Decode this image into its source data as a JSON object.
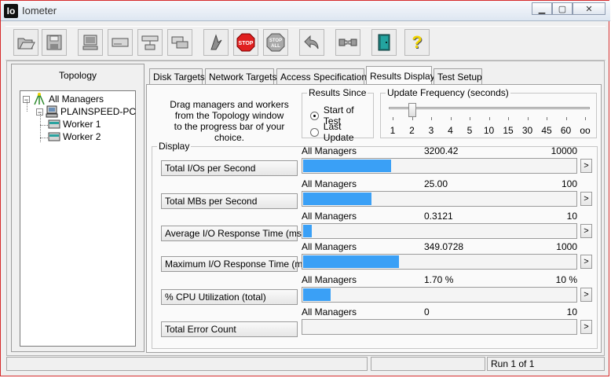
{
  "window": {
    "title": "Iometer",
    "icon_text": "Io"
  },
  "toolbar_icons": [
    "open-icon",
    "save-icon",
    "new-manager-icon",
    "new-disk-worker-icon",
    "new-network-worker-icon",
    "duplicate-worker-icon",
    "start-tests-icon",
    "stop-icon",
    "stop-all-icon",
    "reset-workers-icon",
    "disconnect-icon",
    "exit-icon",
    "about-icon"
  ],
  "toolbar_labels": {
    "stop": "STOP",
    "stop_all_top": "STOP",
    "stop_all_bottom": "ALL",
    "about": "?"
  },
  "topology": {
    "title": "Topology",
    "all_managers": "All Managers",
    "manager": "PLAINSPEED-PC",
    "workers": [
      "Worker 1",
      "Worker 2"
    ]
  },
  "tabs": [
    "Disk Targets",
    "Network Targets",
    "Access Specifications",
    "Results Display",
    "Test Setup"
  ],
  "active_tab": "Results Display",
  "instructions": [
    "Drag managers and workers",
    "from the Topology window",
    "to the progress bar of your choice."
  ],
  "results_since": {
    "label": "Results Since",
    "options": [
      "Start of Test",
      "Last Update"
    ],
    "selected": "Start of Test"
  },
  "update_frequency": {
    "label": "Update Frequency (seconds)",
    "ticks": [
      "1",
      "2",
      "3",
      "4",
      "5",
      "10",
      "15",
      "30",
      "45",
      "60",
      "oo"
    ],
    "selected": "2"
  },
  "display": {
    "label": "Display",
    "metrics": [
      {
        "button": "Total I/Os per Second",
        "scope": "All Managers",
        "value": "3200.42",
        "max": "10000",
        "fraction": 0.32
      },
      {
        "button": "Total MBs per Second",
        "scope": "All Managers",
        "value": "25.00",
        "max": "100",
        "fraction": 0.25
      },
      {
        "button": "Average I/O Response Time (ms)",
        "scope": "All Managers",
        "value": "0.3121",
        "max": "10",
        "fraction": 0.0312
      },
      {
        "button": "Maximum I/O Response Time (ms)",
        "scope": "All Managers",
        "value": "349.0728",
        "max": "1000",
        "fraction": 0.349
      },
      {
        "button": "% CPU Utilization (total)",
        "scope": "All Managers",
        "value": "1.70 %",
        "max": "10 %",
        "fraction": 0.1
      },
      {
        "button": "Total Error Count",
        "scope": "All Managers",
        "value": "0",
        "max": "10",
        "fraction": 0
      }
    ],
    "arrow_glyph": ">"
  },
  "status": {
    "run": "Run 1 of 1"
  }
}
